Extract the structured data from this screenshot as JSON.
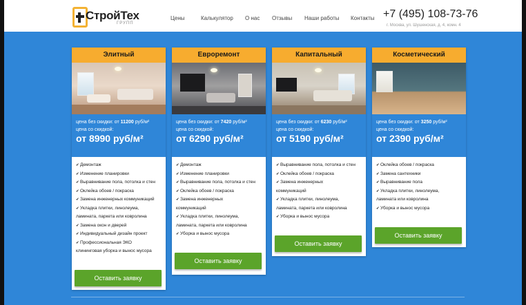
{
  "brand": {
    "name": "СтройТех",
    "sub": "ГРУПП"
  },
  "nav": [
    "Цены",
    "Калькулятор",
    "О нас",
    "Отзывы",
    "Наши работы",
    "Контакты"
  ],
  "contact": {
    "phone": "+7 (495) 108-73-76",
    "address": "г. Москва, ул. Шушенская, д. 4, комн. 4"
  },
  "colors": {
    "accent": "#f7ac2f",
    "background": "#2f86d8",
    "button": "#5ba42a"
  },
  "plans": [
    {
      "title": "Элитный",
      "price_old_label": "цена без скидки: от",
      "price_old": "11200",
      "price_old_unit": "руб/м²",
      "price_new_label": "цена со скидкой:",
      "price_new": "от 8990 руб/м²",
      "features": [
        "Демонтаж",
        "Изменение планировки",
        "Выравнивание пола, потолка и стен",
        "Оклейка обоев / покраска",
        "Замена инженерных коммуникаций",
        "Укладка плитки, линолеума,",
        "ламината, паркета или ковролина",
        "Замена окон и дверей",
        "Индивидуальный дизайн проект",
        "Профессиональная ЭКО",
        "клининговая уборка и вынос мусора"
      ],
      "cta": "Оставить заявку"
    },
    {
      "title": "Евроремонт",
      "price_old_label": "цена без скидки: от",
      "price_old": "7420",
      "price_old_unit": "руб/м²",
      "price_new_label": "цена со скидкой:",
      "price_new": "от 6290 руб/м²",
      "features": [
        "Демонтаж",
        "Изменение планировки",
        "Выравнивание пола, потолка и стен",
        "Оклейка обоев / покраска",
        "Замена инженерных",
        "коммуникаций",
        "Укладка плитки, линолеума,",
        "ламината, паркета или ковролина",
        "Уборка и вынос мусора"
      ],
      "cta": "Оставить заявку"
    },
    {
      "title": "Капитальный",
      "price_old_label": "цена без скидки: от",
      "price_old": "6230",
      "price_old_unit": "руб/м²",
      "price_new_label": "цена со скидкой:",
      "price_new": "от 5190 руб/м²",
      "features": [
        "Выравнивание пола, потолка и стен",
        "Оклейка обоев / покраска",
        "Замена инженерных",
        "коммуникаций",
        "Укладка плитки, линолеума,",
        "ламината, паркета или ковролина",
        "Уборка и вынос мусора"
      ],
      "cta": "Оставить заявку"
    },
    {
      "title": "Косметический",
      "price_old_label": "цена без скидки: от",
      "price_old": "3250",
      "price_old_unit": "руб/м²",
      "price_new_label": "цена со скидкой:",
      "price_new": "от 2390 руб/м²",
      "features": [
        "Оклейка обоев / покраска",
        "Замена сантехники",
        "Выравнивание пола",
        "Укладка плитки, линолеума,",
        "ламината или ковролина",
        "Уборка и вынос мусора"
      ],
      "cta": "Оставить заявку"
    }
  ]
}
